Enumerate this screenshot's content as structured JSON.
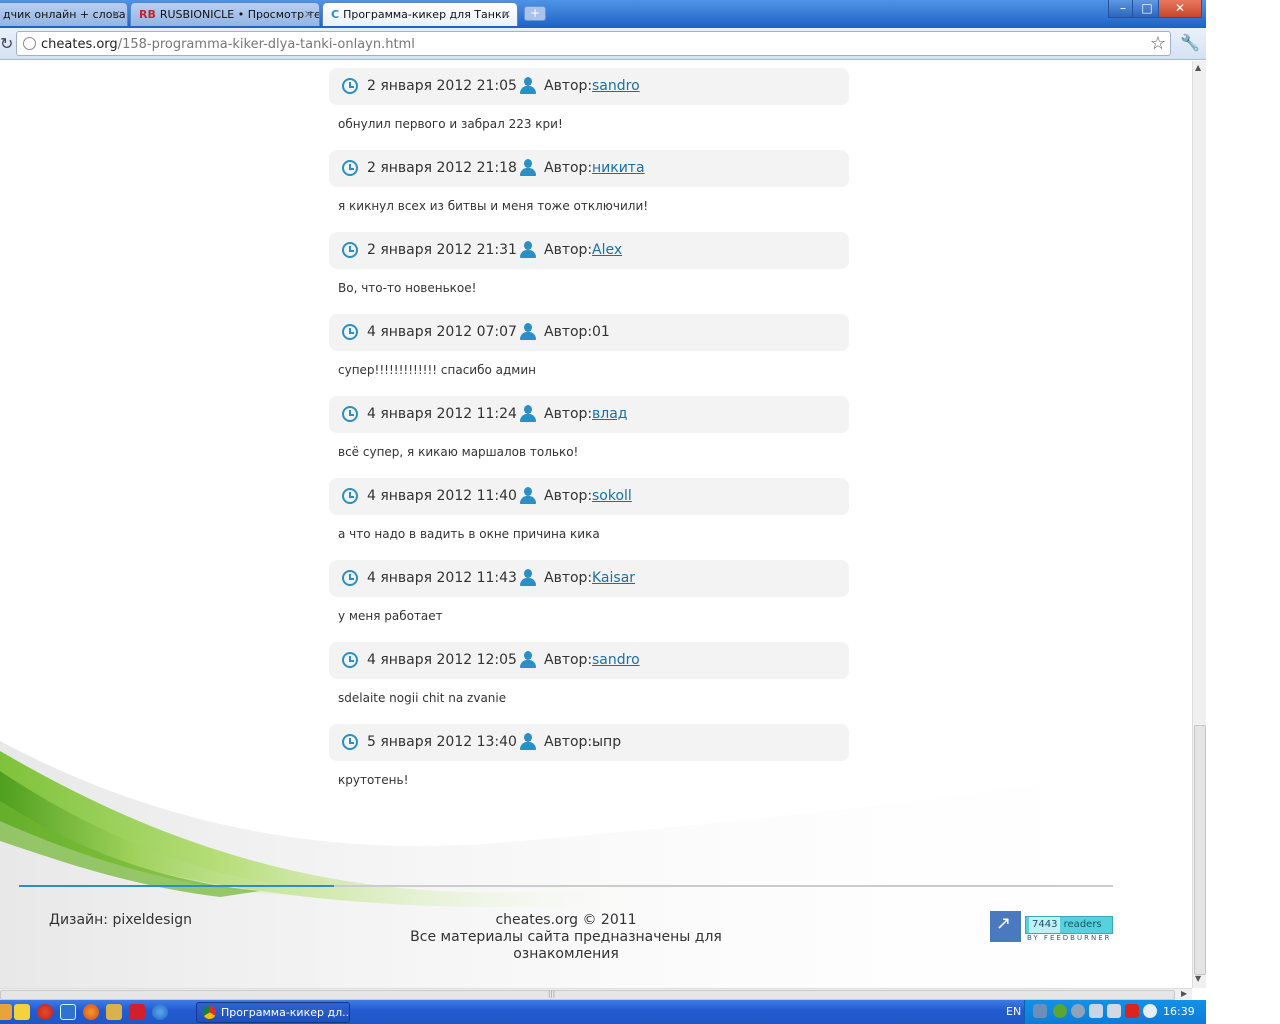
{
  "browser": {
    "tabs": [
      {
        "label": "дчик онлайн + слова",
        "favicon": ""
      },
      {
        "label": "RUSBIONICLE • Просмотр те",
        "favicon": "RB"
      },
      {
        "label": "Программа-кикер для Танки",
        "favicon": "C"
      }
    ],
    "url_host": "cheates.org",
    "url_path": "/158-programma-kiker-dlya-tanki-onlayn.html",
    "window_buttons": [
      "–",
      "□",
      "✕"
    ]
  },
  "comments_label": "Автор:",
  "comments": [
    {
      "date": "2 января 2012 21:05",
      "author": "sandro",
      "author_link": true,
      "text": "обнулил первого и забрал 223 кри!"
    },
    {
      "date": "2 января 2012 21:18",
      "author": "никита",
      "author_link": true,
      "text": "я кикнул всех из битвы и меня тоже отключили!"
    },
    {
      "date": "2 января 2012 21:31",
      "author": "Alex",
      "author_link": true,
      "text": "Во, что-то новенькое!"
    },
    {
      "date": "4 января 2012 07:07",
      "author": "01",
      "author_link": false,
      "text": "супер!!!!!!!!!!!!! спасибо админ"
    },
    {
      "date": "4 января 2012 11:24",
      "author": "влад",
      "author_link": true,
      "text": "всё супер, я кикаю маршалов только!"
    },
    {
      "date": "4 января 2012 11:40",
      "author": "sokoll",
      "author_link": true,
      "text": "а что надо в вадить в окне причина кика"
    },
    {
      "date": "4 января 2012 11:43",
      "author": "Kaisar",
      "author_link": true,
      "text": "у меня работает"
    },
    {
      "date": "4 января 2012 12:05",
      "author": "sandro",
      "author_link": true,
      "text": "sdelaite nogii chit na zvanie"
    },
    {
      "date": "5 января 2012 13:40",
      "author": "ыпр",
      "author_link": false,
      "text": "крутотень!"
    }
  ],
  "footer": {
    "design": "Дизайн: pixeldesign",
    "copyright": "cheates.org © 2011",
    "disclaimer": "Все материалы сайта предназначены для ознакомления",
    "feed_count": "7443",
    "feed_readers": "readers",
    "feed_by": "BY FEEDBURNER"
  },
  "taskbar": {
    "window_title": "Программа-кикер дл...",
    "lang": "EN",
    "time": "16:39"
  },
  "colors": {
    "accent": "#2a8fc4",
    "link": "#1a6fa8",
    "comment_bg": "#f3f3f3",
    "titlebar": "#1c62c4"
  }
}
